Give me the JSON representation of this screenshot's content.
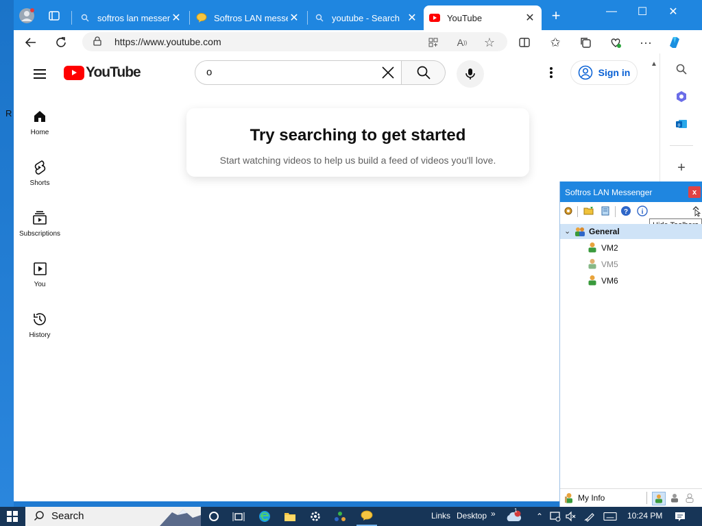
{
  "desktop": {
    "edge_letter": "R"
  },
  "browser": {
    "tabs": [
      {
        "title": "softros lan messeng",
        "icon": "search-icon"
      },
      {
        "title": "Softros LAN messen",
        "icon": "softros-icon"
      },
      {
        "title": "youtube - Search",
        "icon": "search-icon"
      },
      {
        "title": "YouTube",
        "icon": "youtube-icon",
        "active": true
      }
    ],
    "url": "https://www.youtube.com"
  },
  "youtube": {
    "logo_text": "YouTube",
    "search_value": "o",
    "signin_label": "Sign in",
    "guide": [
      {
        "label": "Home",
        "icon": "home-icon"
      },
      {
        "label": "Shorts",
        "icon": "shorts-icon"
      },
      {
        "label": "Subscriptions",
        "icon": "subscriptions-icon"
      },
      {
        "label": "You",
        "icon": "you-icon"
      },
      {
        "label": "History",
        "icon": "history-icon"
      }
    ],
    "prompt_title": "Try searching to get started",
    "prompt_subtitle": "Start watching videos to help us build a feed of videos you'll love."
  },
  "softros": {
    "title": "Softros LAN Messenger",
    "close_label": "x",
    "tooltip": "Hide Toolbars",
    "group": "General",
    "users": [
      {
        "name": "VM2",
        "online": true
      },
      {
        "name": "VM5",
        "online": false
      },
      {
        "name": "VM6",
        "online": true
      }
    ],
    "my_info_label": "My Info"
  },
  "taskbar": {
    "search_label": "Search",
    "links_label": "Links",
    "desktop_label": "Desktop",
    "chevron": "»",
    "time": "10:24 PM",
    "weather_badge": "1"
  },
  "colors": {
    "tab_bar": "#1f86e0",
    "youtube_red": "#ff0000",
    "signin_blue": "#065fd4",
    "taskbar": "#173557"
  }
}
